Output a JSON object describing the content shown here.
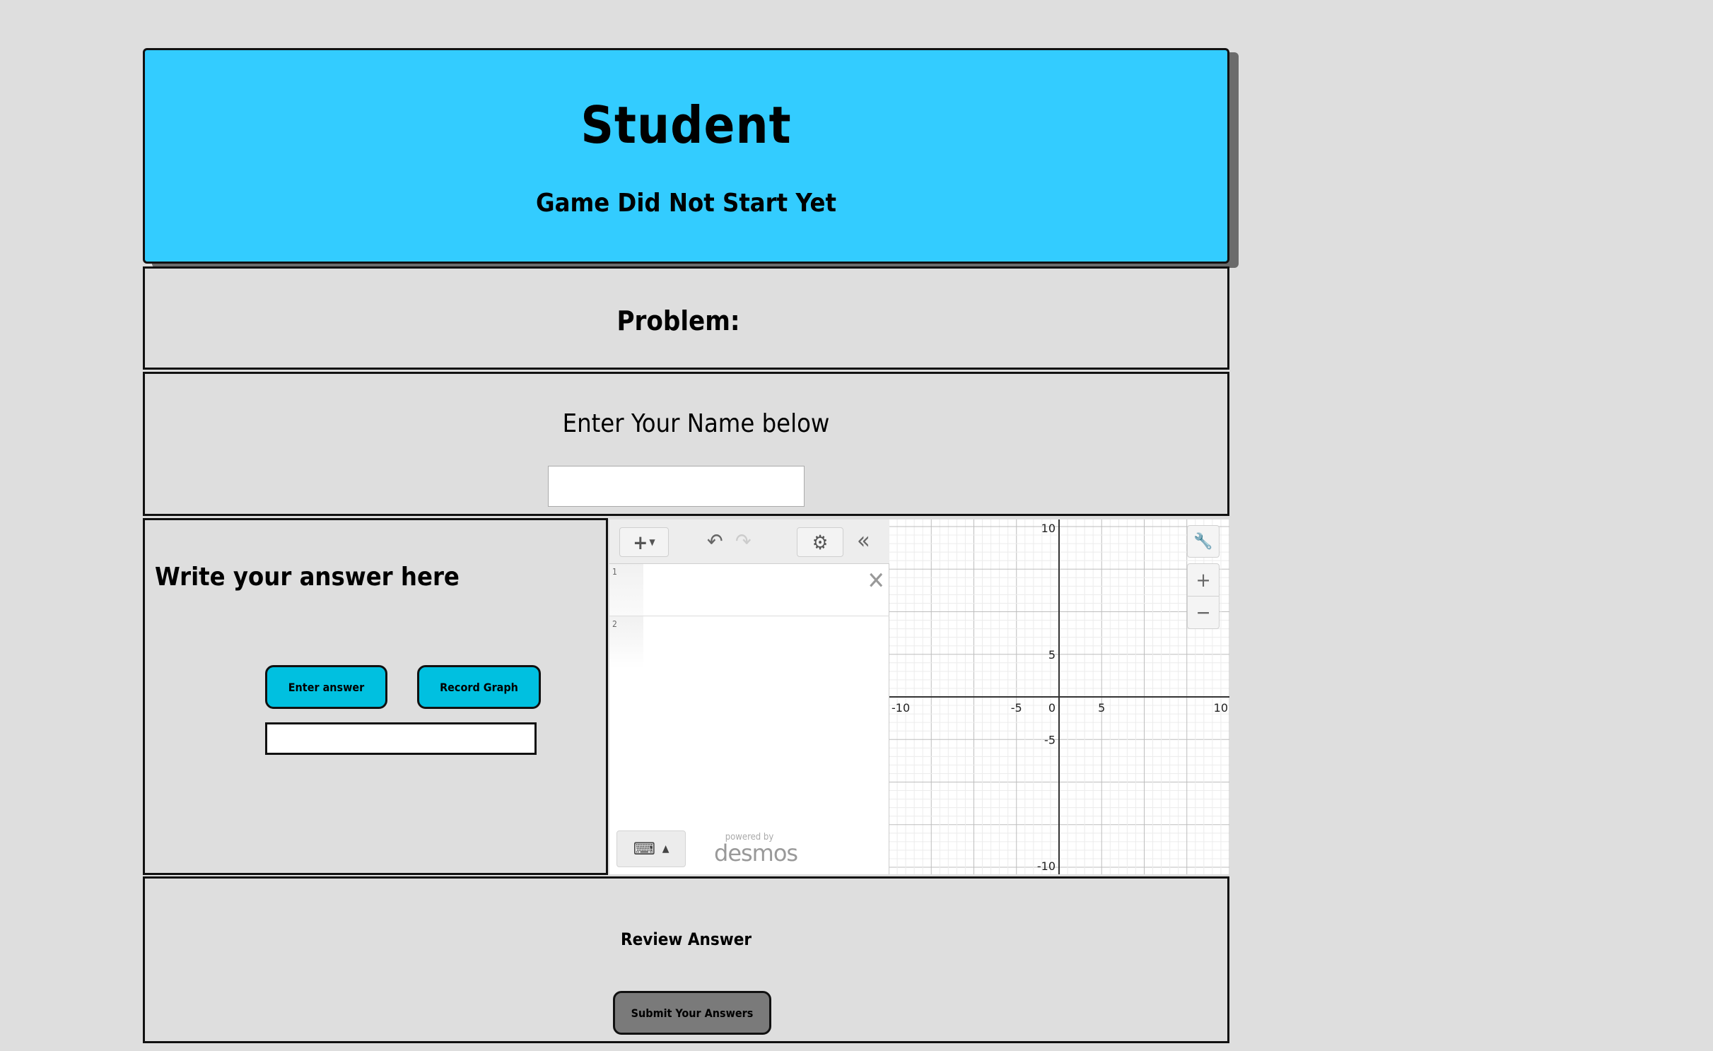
{
  "header": {
    "title": "Student",
    "status": "Game Did Not Start Yet"
  },
  "problem": {
    "label": "Problem:"
  },
  "name_section": {
    "label": "Enter Your Name below",
    "input_value": ""
  },
  "answer_section": {
    "label": "Write your answer here",
    "enter_button": "Enter answer",
    "record_button": "Record Graph",
    "answer_value": ""
  },
  "desmos": {
    "expressions": [
      {
        "number": "1",
        "value": ""
      },
      {
        "number": "2",
        "value": ""
      }
    ],
    "powered_by": "powered by",
    "brand": "desmos",
    "axis": {
      "x_labels": [
        "-10",
        "-5",
        "0",
        "5",
        "10"
      ],
      "y_labels": [
        "10",
        "5",
        "-5",
        "-10"
      ],
      "x_range": [
        -10,
        10
      ],
      "y_range": [
        -10,
        10
      ]
    },
    "icons": [
      "add-icon",
      "undo-icon",
      "redo-icon",
      "gear-icon",
      "collapse-icon",
      "close-icon",
      "keyboard-icon",
      "wrench-icon",
      "plus-icon",
      "minus-icon"
    ]
  },
  "review_section": {
    "label": "Review Answer",
    "submit_button": "Submit Your Answers"
  },
  "colors": {
    "background": "#dedede",
    "header": "#33ccff",
    "primary_button": "#00c0e0",
    "submit_button": "#7a7a7a"
  }
}
